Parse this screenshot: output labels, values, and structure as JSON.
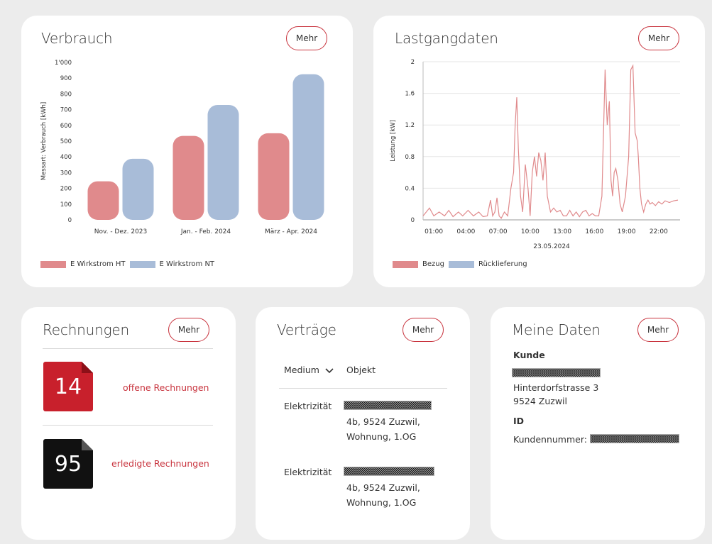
{
  "verbrauch": {
    "title": "Verbrauch",
    "mehr": "Mehr",
    "chart_data": {
      "type": "bar",
      "ylabel": "Messart: Verbrauch [kWh]",
      "ylim": [
        0,
        1000
      ],
      "yticks": [
        "0",
        "100",
        "200",
        "300",
        "400",
        "500",
        "600",
        "700",
        "800",
        "900",
        "1'000"
      ],
      "categories": [
        "Nov. - Dez. 2023",
        "Jan. - Feb. 2024",
        "März - Apr. 2024"
      ],
      "series": [
        {
          "name": "E Wirkstrom HT",
          "values": [
            245,
            533,
            550
          ],
          "color": "#e08a8c"
        },
        {
          "name": "E Wirkstrom NT",
          "values": [
            388,
            730,
            925
          ],
          "color": "#a8bcd8"
        }
      ],
      "legend": "bottom-left"
    }
  },
  "lastgang": {
    "title": "Lastgangdaten",
    "mehr": "Mehr",
    "chart_data": {
      "type": "line",
      "ylabel": "Leistung [kW]",
      "xlabel": "23.05.2024",
      "ylim": [
        0,
        2
      ],
      "yticks": [
        "0",
        "0.4",
        "0.8",
        "1.2",
        "1.6",
        "2"
      ],
      "xticks": [
        "01:00",
        "04:00",
        "07:00",
        "10:00",
        "13:00",
        "16:00",
        "19:00",
        "22:00"
      ],
      "x_hours": [
        0,
        0.3,
        0.6,
        1,
        1.5,
        2,
        2.4,
        2.8,
        3.3,
        3.7,
        4.2,
        4.7,
        5.2,
        5.6,
        6,
        6.3,
        6.5,
        6.7,
        6.9,
        7.1,
        7.3,
        7.6,
        7.9,
        8.2,
        8.45,
        8.6,
        8.75,
        8.9,
        9.1,
        9.3,
        9.55,
        9.8,
        10,
        10.2,
        10.4,
        10.6,
        10.8,
        11,
        11.2,
        11.4,
        11.6,
        11.9,
        12.2,
        12.5,
        12.8,
        13.1,
        13.4,
        13.7,
        14,
        14.3,
        14.6,
        14.9,
        15.2,
        15.5,
        15.8,
        16.1,
        16.4,
        16.7,
        17,
        17.2,
        17.4,
        17.55,
        17.7,
        17.85,
        18,
        18.2,
        18.4,
        18.6,
        18.9,
        19.2,
        19.4,
        19.6,
        19.8,
        20,
        20.1,
        20.25,
        20.4,
        20.6,
        20.8,
        21,
        21.2,
        21.4,
        21.7,
        22,
        22.3,
        22.6,
        23,
        23.4,
        23.8
      ],
      "values": [
        0.05,
        0.1,
        0.15,
        0.05,
        0.1,
        0.05,
        0.12,
        0.04,
        0.1,
        0.05,
        0.12,
        0.05,
        0.1,
        0.04,
        0.05,
        0.25,
        0.05,
        0.1,
        0.28,
        0.05,
        0.02,
        0.1,
        0.05,
        0.4,
        0.6,
        1.2,
        1.55,
        0.9,
        0.3,
        0.1,
        0.7,
        0.4,
        0.05,
        0.6,
        0.8,
        0.55,
        0.85,
        0.75,
        0.5,
        0.85,
        0.3,
        0.1,
        0.15,
        0.1,
        0.12,
        0.05,
        0.05,
        0.12,
        0.05,
        0.1,
        0.04,
        0.1,
        0.12,
        0.05,
        0.08,
        0.05,
        0.05,
        0.3,
        1.9,
        1.2,
        1.5,
        0.5,
        0.3,
        0.6,
        0.65,
        0.5,
        0.2,
        0.1,
        0.3,
        0.8,
        1.9,
        1.95,
        1.1,
        1.0,
        0.8,
        0.4,
        0.2,
        0.1,
        0.2,
        0.25,
        0.2,
        0.22,
        0.18,
        0.23,
        0.2,
        0.24,
        0.22,
        0.24,
        0.25
      ],
      "series": [
        {
          "name": "Bezug",
          "color": "#e08a8c"
        },
        {
          "name": "Rücklieferung",
          "color": "#a8bcd8"
        }
      ],
      "legend": "bottom-left"
    }
  },
  "rechnungen": {
    "title": "Rechnungen",
    "mehr": "Mehr",
    "open_count": "14",
    "open_label": "offene Rechnungen",
    "done_count": "95",
    "done_label": "erledigte Rechnungen"
  },
  "vertraege": {
    "title": "Verträge",
    "mehr": "Mehr",
    "col_medium": "Medium",
    "col_objekt": "Objekt",
    "rows": [
      {
        "medium": "Elektrizität",
        "line1": "4b, 9524 Zuzwil,",
        "line2": "Wohnung, 1.OG"
      },
      {
        "medium": "Elektrizität",
        "line1": "4b, 9524 Zuzwil,",
        "line2": "Wohnung, 1.OG"
      }
    ]
  },
  "meine_daten": {
    "title": "Meine Daten",
    "mehr": "Mehr",
    "kunde_label": "Kunde",
    "street": "Hinterdorfstrasse 3",
    "city": "9524 Zuzwil",
    "id_label": "ID",
    "kundennummer_label": "Kundennummer:"
  }
}
